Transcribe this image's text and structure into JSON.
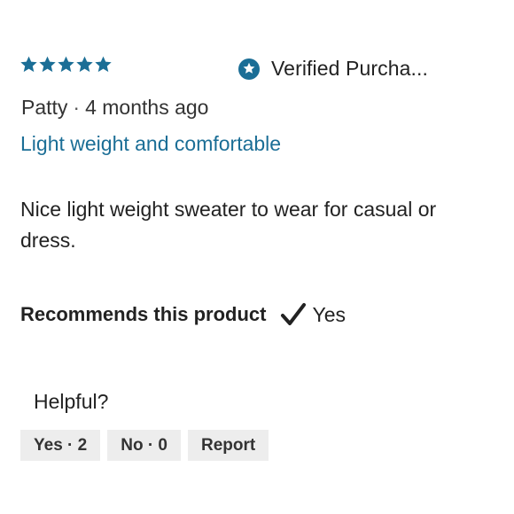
{
  "review": {
    "rating": 5,
    "rating_max": 5,
    "star_color": "#1b6e96",
    "verified_label": "Verified Purcha...",
    "author": "Patty",
    "separator": "·",
    "posted": "4 months ago",
    "title": "Light weight and comfortable",
    "body": "Nice light weight sweater to wear for casual or dress.",
    "recommend_label": "Recommends this product",
    "recommend_value": "Yes"
  },
  "feedback": {
    "helpful_label": "Helpful?",
    "yes_button": "Yes · 2",
    "no_button": "No · 0",
    "report_button": "Report"
  },
  "icons": {
    "star": "star-icon",
    "verified": "verified-badge-icon",
    "check": "checkmark-icon"
  }
}
